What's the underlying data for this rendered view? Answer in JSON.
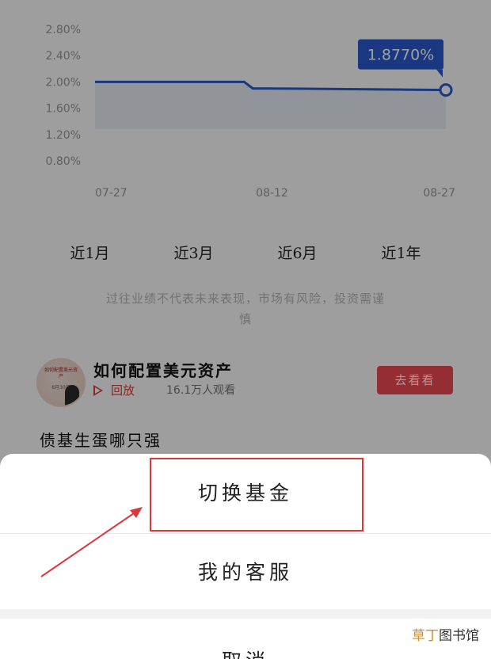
{
  "chart_data": {
    "type": "line",
    "x": [
      "07-27",
      "08-12",
      "08-27"
    ],
    "series": [
      {
        "values": [
          2.0,
          1.9,
          1.877
        ]
      }
    ],
    "y_ticks": [
      "2.80%",
      "2.40%",
      "2.00%",
      "1.60%",
      "1.20%",
      "0.80%"
    ],
    "x_ticks": [
      "07-27",
      "08-12",
      "08-27"
    ],
    "ylim": [
      0.8,
      2.8
    ],
    "tooltip": "1.8770%",
    "colors": {
      "line": "#2a5bd0",
      "tooltip_bg": "#2a5bd0",
      "area": "#e9eef8"
    }
  },
  "tabs": [
    {
      "label": "近1月"
    },
    {
      "label": "近3月"
    },
    {
      "label": "近6月"
    },
    {
      "label": "近1年"
    }
  ],
  "disclaimer": {
    "line1": "过往业绩不代表未来表现，市场有风险，投资需谨",
    "line2": "慎"
  },
  "live_card": {
    "thumb_text": "如何配置美元资产",
    "thumb_sub": "8月30日",
    "title": "如何配置美元资产",
    "replay_label": "回放",
    "viewers": "16.1万人观看",
    "button_label": "去看看"
  },
  "section_title": "债基生蛋哪只强",
  "action_sheet": {
    "items": [
      "切换基金",
      "我的客服",
      "取消"
    ]
  },
  "watermark": {
    "part1": "草丁",
    "part2": "图书馆"
  },
  "colors": {
    "accent": "#2a5bd0",
    "brand_red": "#f04a54",
    "highlight": "#e0363a"
  }
}
